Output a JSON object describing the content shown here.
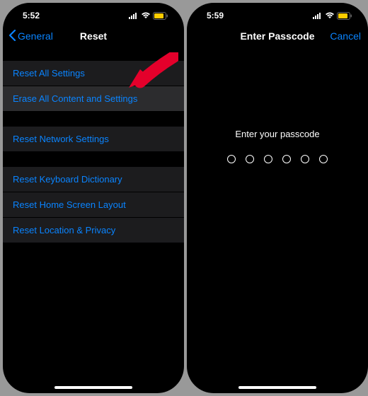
{
  "left": {
    "status": {
      "time": "5:52"
    },
    "nav": {
      "back": "General",
      "title": "Reset"
    },
    "groups": [
      {
        "rows": [
          "Reset All Settings",
          "Erase All Content and Settings"
        ],
        "highlight_index": 1
      },
      {
        "rows": [
          "Reset Network Settings"
        ]
      },
      {
        "rows": [
          "Reset Keyboard Dictionary",
          "Reset Home Screen Layout",
          "Reset Location & Privacy"
        ]
      }
    ]
  },
  "right": {
    "status": {
      "time": "5:59"
    },
    "nav": {
      "title": "Enter Passcode",
      "cancel": "Cancel"
    },
    "prompt": "Enter your passcode",
    "passcode_length": 6
  },
  "colors": {
    "accent": "#0a84ff",
    "battery": "#ffcc00"
  }
}
